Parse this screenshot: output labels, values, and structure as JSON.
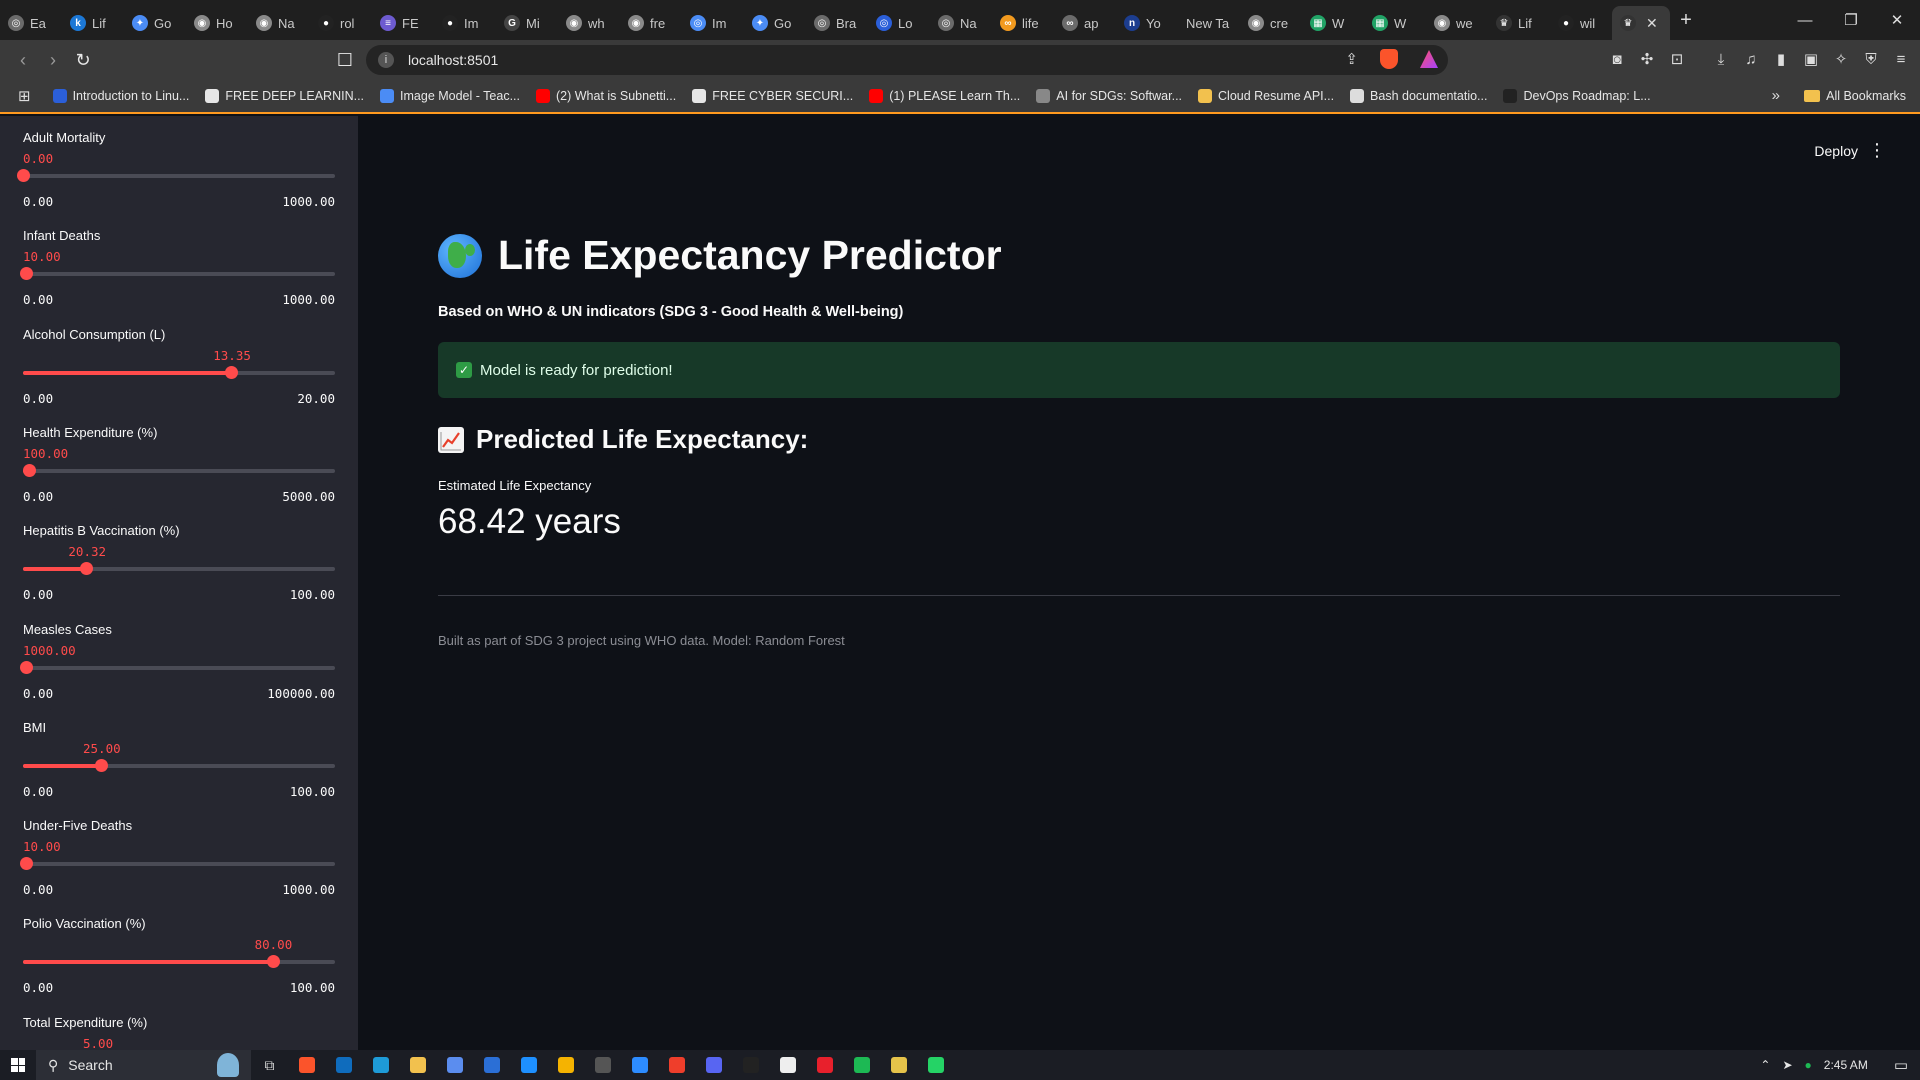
{
  "browser": {
    "tabs": [
      {
        "label": "Ea",
        "icon_color": "#6b6b6b",
        "glyph": "◎"
      },
      {
        "label": "Lif",
        "icon_color": "#1c78d6",
        "glyph": "k"
      },
      {
        "label": "Go",
        "icon_color": "#4b8cf5",
        "glyph": "✦"
      },
      {
        "label": "Ho",
        "icon_color": "#8a8a8a",
        "glyph": "◉"
      },
      {
        "label": "Na",
        "icon_color": "#8a8a8a",
        "glyph": "◉"
      },
      {
        "label": "rol",
        "icon_color": "#222",
        "glyph": "●"
      },
      {
        "label": "FE",
        "icon_color": "#6d5bd0",
        "glyph": "≡"
      },
      {
        "label": "Im",
        "icon_color": "#222",
        "glyph": "●"
      },
      {
        "label": "Mi",
        "icon_color": "#444",
        "glyph": "G"
      },
      {
        "label": "wh",
        "icon_color": "#8a8a8a",
        "glyph": "◉"
      },
      {
        "label": "fre",
        "icon_color": "#8a8a8a",
        "glyph": "◉"
      },
      {
        "label": "Im",
        "icon_color": "#4b8cf5",
        "glyph": "◎"
      },
      {
        "label": "Go",
        "icon_color": "#4b8cf5",
        "glyph": "✦"
      },
      {
        "label": "Bra",
        "icon_color": "#6b6b6b",
        "glyph": "◎"
      },
      {
        "label": "Lo",
        "icon_color": "#2b5fd9",
        "glyph": "◎"
      },
      {
        "label": "Na",
        "icon_color": "#6b6b6b",
        "glyph": "◎"
      },
      {
        "label": "life",
        "icon_color": "#f29a1f",
        "glyph": "∞"
      },
      {
        "label": "ap",
        "icon_color": "#6b6b6b",
        "glyph": "∞"
      },
      {
        "label": "Yo",
        "icon_color": "#1c3d8f",
        "glyph": "n"
      },
      {
        "label": "New Ta",
        "icon_color": "",
        "glyph": ""
      },
      {
        "label": "cre",
        "icon_color": "#8a8a8a",
        "glyph": "◉"
      },
      {
        "label": "W",
        "icon_color": "#21a366",
        "glyph": "▦"
      },
      {
        "label": "W",
        "icon_color": "#21a366",
        "glyph": "▦"
      },
      {
        "label": "we",
        "icon_color": "#8a8a8a",
        "glyph": "◉"
      },
      {
        "label": "Lif",
        "icon_color": "#333",
        "glyph": "♛"
      },
      {
        "label": "wil",
        "icon_color": "#222",
        "glyph": "●"
      }
    ],
    "active_tab_close": "✕",
    "new_tab": "+",
    "window_controls": [
      "—",
      "❐",
      "✕"
    ],
    "url": "localhost:8501",
    "bookmarks": [
      {
        "label": "Introduction to Linu...",
        "icon_color": "#2b5fd9"
      },
      {
        "label": "FREE DEEP LEARNIN...",
        "icon_color": "#e6e6e6"
      },
      {
        "label": "Image Model - Teac...",
        "icon_color": "#4b8cf5"
      },
      {
        "label": "(2) What is Subnetti...",
        "icon_color": "#ff0000"
      },
      {
        "label": "FREE CYBER SECURI...",
        "icon_color": "#e6e6e6"
      },
      {
        "label": "(1) PLEASE Learn Th...",
        "icon_color": "#ff0000"
      },
      {
        "label": "AI for SDGs: Softwar...",
        "icon_color": "#888"
      },
      {
        "label": "Cloud Resume API...",
        "icon_color": "#f2c14e"
      },
      {
        "label": "Bash documentatio...",
        "icon_color": "#ddd"
      },
      {
        "label": "DevOps Roadmap: L...",
        "icon_color": "#222"
      }
    ],
    "bookmarks_overflow": "»",
    "all_bookmarks": "All Bookmarks"
  },
  "sidebar": {
    "sliders": [
      {
        "label": "Adult Mortality",
        "value": "0.00",
        "min": "0.00",
        "max": "1000.00",
        "fraction": 0.0
      },
      {
        "label": "Infant Deaths",
        "value": "10.00",
        "min": "0.00",
        "max": "1000.00",
        "fraction": 0.01
      },
      {
        "label": "Alcohol Consumption (L)",
        "value": "13.35",
        "min": "0.00",
        "max": "20.00",
        "fraction": 0.6675
      },
      {
        "label": "Health Expenditure (%)",
        "value": "100.00",
        "min": "0.00",
        "max": "5000.00",
        "fraction": 0.02
      },
      {
        "label": "Hepatitis B Vaccination (%)",
        "value": "20.32",
        "min": "0.00",
        "max": "100.00",
        "fraction": 0.2032
      },
      {
        "label": "Measles Cases",
        "value": "1000.00",
        "min": "0.00",
        "max": "100000.00",
        "fraction": 0.01
      },
      {
        "label": "BMI",
        "value": "25.00",
        "min": "0.00",
        "max": "100.00",
        "fraction": 0.25
      },
      {
        "label": "Under-Five Deaths",
        "value": "10.00",
        "min": "0.00",
        "max": "1000.00",
        "fraction": 0.01
      },
      {
        "label": "Polio Vaccination (%)",
        "value": "80.00",
        "min": "0.00",
        "max": "100.00",
        "fraction": 0.8
      },
      {
        "label": "Total Expenditure (%)",
        "value": "5.00",
        "min": "",
        "max": "",
        "fraction": 0.25
      }
    ]
  },
  "main": {
    "deploy_label": "Deploy",
    "menu_glyph": "⋮",
    "title": "Life Expectancy Predictor",
    "subtitle": "Based on WHO & UN indicators (SDG 3 - Good Health & Well-being)",
    "status": "Model is ready for prediction!",
    "prediction_heading": "Predicted Life Expectancy:",
    "metric_label": "Estimated Life Expectancy",
    "metric_value": "68.42 years",
    "caption": "Built as part of SDG 3 project using WHO data. Model: Random Forest",
    "accent_color": "#ff4b4b"
  },
  "taskbar": {
    "search_label": "Search",
    "time": "2:45 AM",
    "apps": [
      "#fb542b",
      "#0f6cbd",
      "#1e9bd7",
      "#f2c14e",
      "#5b8def",
      "#2b6fd6",
      "#1e90ff",
      "#f5b301",
      "#555",
      "#2d8cff",
      "#ef3e2b",
      "#5865f2",
      "#222",
      "#eee",
      "#e8202c",
      "#1db954",
      "#e6c34a",
      "#25d366"
    ]
  }
}
